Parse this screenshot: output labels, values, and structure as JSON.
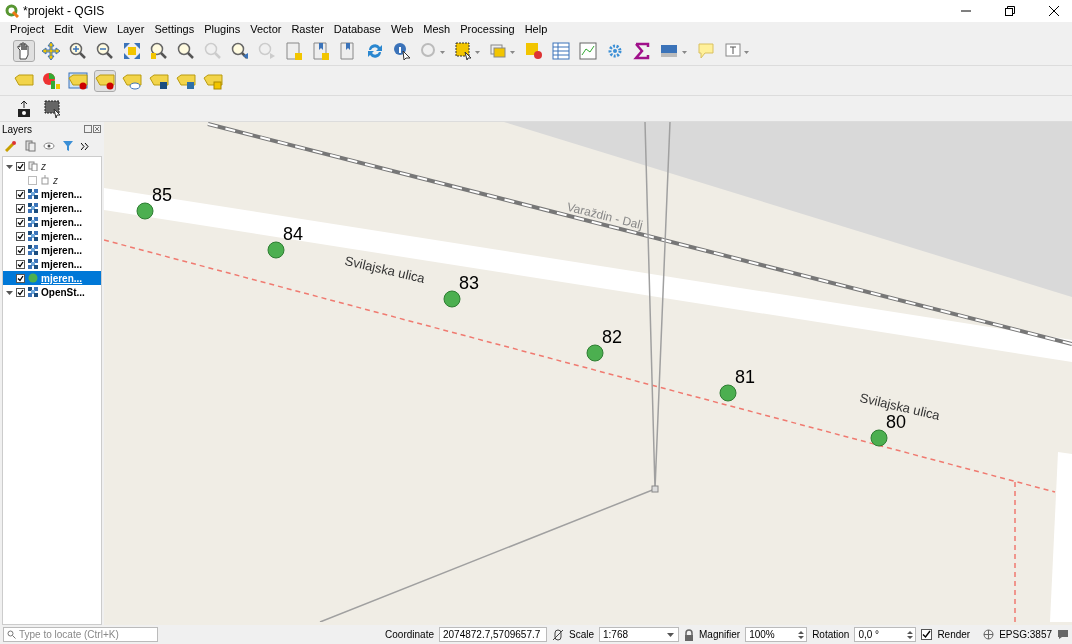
{
  "window": {
    "title": "*projekt - QGIS"
  },
  "menu": [
    "Project",
    "Edit",
    "View",
    "Layer",
    "Settings",
    "Plugins",
    "Vector",
    "Raster",
    "Database",
    "Web",
    "Mesh",
    "Processing",
    "Help"
  ],
  "layers_panel": {
    "title": "Layers",
    "items": [
      {
        "label": "z",
        "kind": "group",
        "checked": true,
        "expanded": true,
        "selected": false,
        "children": [
          {
            "label": "z",
            "kind": "table",
            "checked": false,
            "selected": false
          }
        ]
      },
      {
        "label": "mjeren...",
        "kind": "raster",
        "checked": true,
        "selected": false
      },
      {
        "label": "mjeren...",
        "kind": "raster",
        "checked": true,
        "selected": false
      },
      {
        "label": "mjeren...",
        "kind": "raster",
        "checked": true,
        "selected": false
      },
      {
        "label": "mjeren...",
        "kind": "raster",
        "checked": true,
        "selected": false
      },
      {
        "label": "mjeren...",
        "kind": "raster",
        "checked": true,
        "selected": false
      },
      {
        "label": "mjeren...",
        "kind": "raster",
        "checked": true,
        "selected": false
      },
      {
        "label": "mjeren...",
        "kind": "point",
        "checked": true,
        "selected": true
      },
      {
        "label": "OpenSt...",
        "kind": "raster",
        "checked": true,
        "expanded": true,
        "selected": false
      }
    ]
  },
  "map": {
    "rail_label": "Varaždin - Dalj",
    "street_labels": [
      "Svilajska ulica",
      "Svilajska ulica"
    ],
    "points": [
      "85",
      "84",
      "83",
      "82",
      "81",
      "80"
    ]
  },
  "status_bar": {
    "locate": {
      "placeholder": "Type to locate (Ctrl+K)"
    },
    "coordinate_label": "Coordinate",
    "coordinate": "2074872.7,5709657.7",
    "scale_label": "Scale",
    "scale": "1:768",
    "magnifier_label": "Magnifier",
    "magnifier": "100%",
    "rotation_label": "Rotation",
    "rotation": "0,0 °",
    "render_label": "Render",
    "render": true,
    "crs": "EPSG:3857"
  }
}
